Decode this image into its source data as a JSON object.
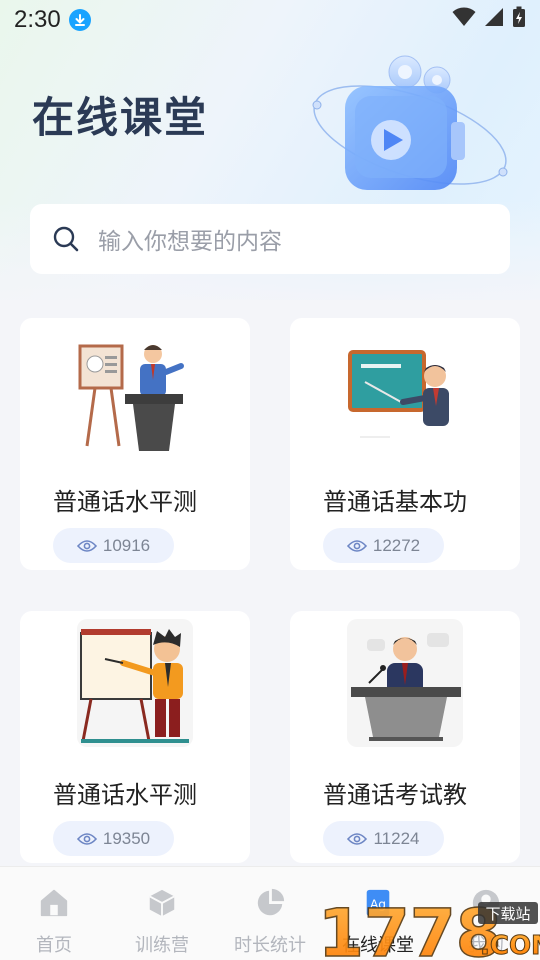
{
  "status": {
    "time": "2:30"
  },
  "header": {
    "title": "在线课堂"
  },
  "search": {
    "placeholder": "输入你想要的内容"
  },
  "courses": [
    {
      "title": "普通话水平测",
      "views": "10916"
    },
    {
      "title": "普通话基本功",
      "views": "12272"
    },
    {
      "title": "普通话水平测",
      "views": "19350"
    },
    {
      "title": "普通话考试教",
      "views": "11224"
    }
  ],
  "tabs": [
    {
      "label": "首页",
      "icon": "home-icon"
    },
    {
      "label": "训练营",
      "icon": "cube-icon"
    },
    {
      "label": "时长统计",
      "icon": "pie-chart-icon"
    },
    {
      "label": "在线课堂",
      "icon": "classroom-icon",
      "active": true
    },
    {
      "label": "我的",
      "icon": "profile-icon"
    }
  ],
  "watermark": {
    "number": "1778",
    "label_top": "下载站",
    "label_bottom": ".COM"
  },
  "colors": {
    "accent": "#1aa3ff",
    "title": "#2b3a55",
    "pill": "#edf2fd"
  }
}
